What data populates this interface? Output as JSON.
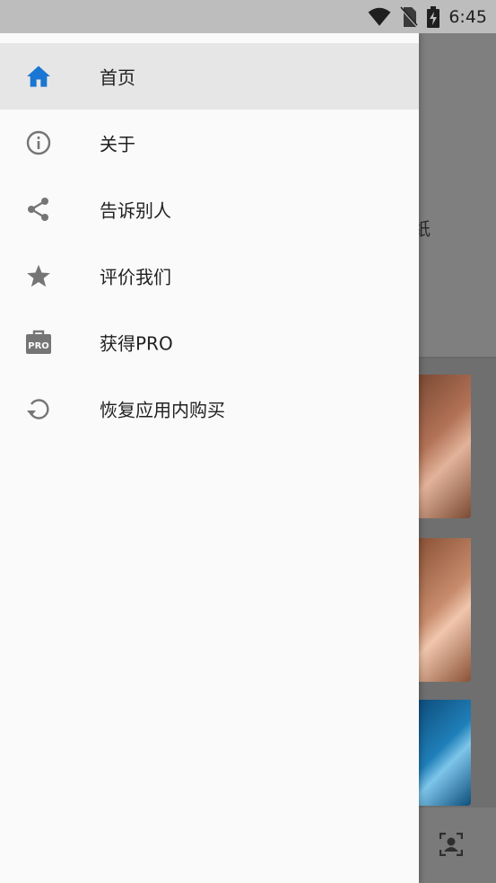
{
  "status_bar": {
    "time": "6:45"
  },
  "background": {
    "partial_text": "纸"
  },
  "drawer": {
    "items": [
      {
        "label": "首页",
        "icon": "home-icon",
        "active": true
      },
      {
        "label": "关于",
        "icon": "info-icon",
        "active": false
      },
      {
        "label": "告诉别人",
        "icon": "share-icon",
        "active": false
      },
      {
        "label": "评价我们",
        "icon": "star-icon",
        "active": false
      },
      {
        "label": "获得PRO",
        "icon": "pro-bag-icon",
        "active": false
      },
      {
        "label": "恢复应用内购买",
        "icon": "restore-icon",
        "active": false
      }
    ]
  },
  "colors": {
    "accent": "#1976d2",
    "icon_grey": "#757575",
    "drawer_bg": "#fafafa",
    "active_bg": "#e6e6e6"
  }
}
